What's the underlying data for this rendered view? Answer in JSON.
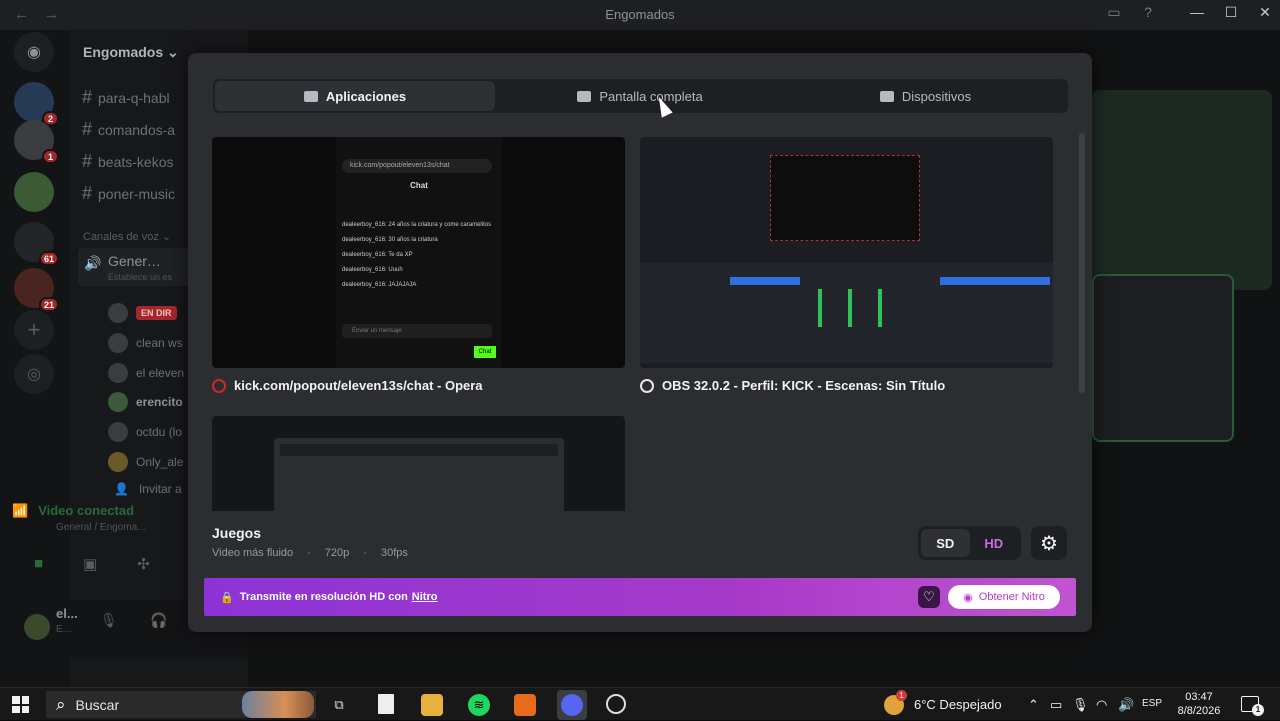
{
  "window": {
    "title": "Engomados"
  },
  "guild": {
    "name": "Engomados ⌄"
  },
  "servers": [
    {
      "badge": "2"
    },
    {
      "badge": "1"
    },
    {
      "badge": ""
    },
    {
      "badge": "61"
    },
    {
      "badge": "21"
    }
  ],
  "channels": {
    "text": [
      "para-q-habl",
      "comandos-a",
      "beats-kekos",
      "poner-music"
    ],
    "voice_category": "Canales de voz ⌄",
    "voice_channel": "Gener…",
    "voice_channel_sub": "Establece un es",
    "live_label": "EN DIR",
    "members": [
      "clean ws",
      "el eleven",
      "erencito",
      "octdu (lo",
      "Only_ale"
    ],
    "invite": "Invitar a"
  },
  "voice_panel": {
    "status": "Video conectad",
    "location": "General / Engoma..."
  },
  "user": {
    "name": "el...",
    "status": "E..."
  },
  "modal": {
    "tabs": [
      {
        "label": "Aplicaciones"
      },
      {
        "label": "Pantalla completa"
      },
      {
        "label": "Dispositivos"
      }
    ],
    "sources": [
      {
        "title": "kick.com/popout/eleven13s/chat - Opera"
      },
      {
        "title": "OBS 32.0.2 - Perfil: KICK - Escenas: Sin Título"
      }
    ],
    "chat_preview": {
      "url": "kick.com/popout/eleven13s/chat",
      "header": "Chat",
      "lines": [
        "dealeerboy_616: 24 años la criatura y come caramelitos",
        "dealeerboy_616: 30 años la criatura",
        "dealeerboy_616: Te da XP",
        "dealeerboy_616: Uuuh",
        "dealeerboy_616: JAJAJAJA"
      ],
      "input_placeholder": "Enviar un mensaje",
      "send": "Chat"
    },
    "quality": {
      "title": "Juegos",
      "subtitle": "Video más fluido",
      "resolution": "720p",
      "fps": "30fps"
    },
    "res_options": {
      "sd": "SD",
      "hd": "HD"
    },
    "nitro": {
      "text": "Transmite en resolución HD con",
      "link": "Nitro",
      "button": "Obtener Nitro"
    }
  },
  "taskbar": {
    "search": "Buscar",
    "weather": "6°C  Despejado",
    "weather_badge": "1",
    "lang": "ESP",
    "time": "03:47",
    "date": "8/8/2026",
    "notifications": "1"
  }
}
